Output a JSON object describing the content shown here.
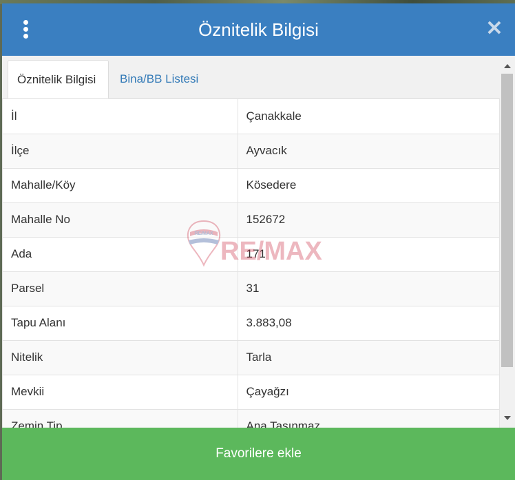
{
  "header": {
    "title": "Öznitelik Bilgisi",
    "menu_icon": "vertical-dots-icon",
    "close_icon": "close-icon",
    "color": "#3a7fc1"
  },
  "tabs": [
    {
      "label": "Öznitelik Bilgisi",
      "active": true
    },
    {
      "label": "Bina/BB Listesi",
      "active": false
    }
  ],
  "attributes": [
    {
      "key": "İl",
      "value": "Çanakkale"
    },
    {
      "key": "İlçe",
      "value": "Ayvacık"
    },
    {
      "key": "Mahalle/Köy",
      "value": "Kösedere"
    },
    {
      "key": "Mahalle No",
      "value": "152672"
    },
    {
      "key": "Ada",
      "value": "171"
    },
    {
      "key": "Parsel",
      "value": "31"
    },
    {
      "key": "Tapu Alanı",
      "value": "3.883,08"
    },
    {
      "key": "Nitelik",
      "value": "Tarla"
    },
    {
      "key": "Mevkii",
      "value": "Çayağzı"
    },
    {
      "key": "Zemin Tip",
      "value": "Ana Taşınmaz"
    }
  ],
  "watermark": {
    "text": "RE/MAX",
    "badge_text": "RE/MAX"
  },
  "footer": {
    "button_label": "Favorilere ekle",
    "color": "#5cb85c"
  }
}
